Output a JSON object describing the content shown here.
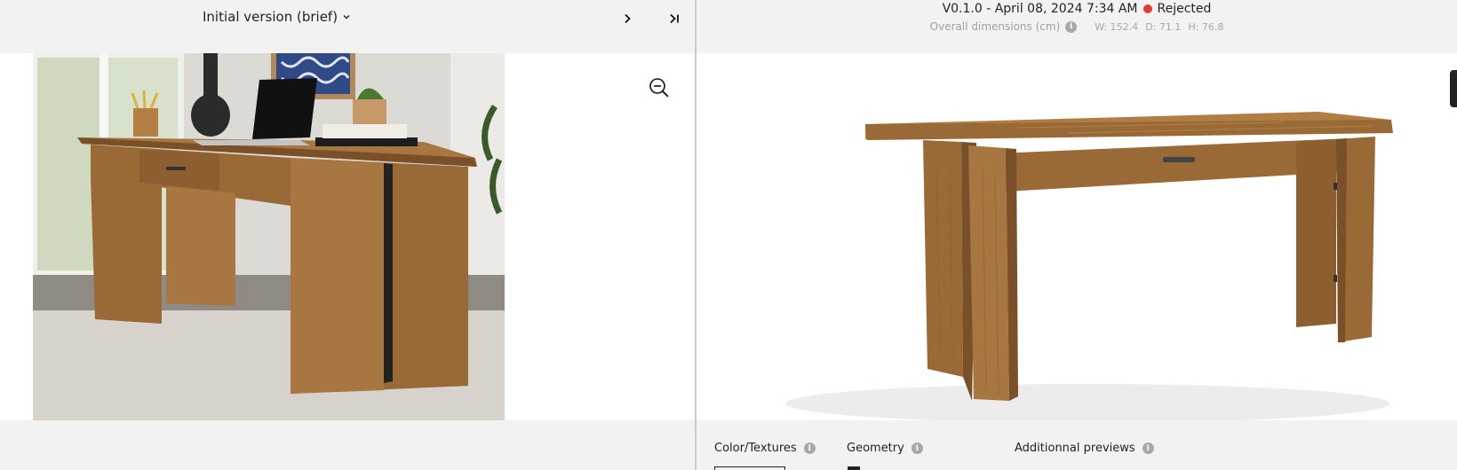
{
  "left": {
    "version_label": "Initial version (brief)",
    "next_icon": "chevron-right-icon",
    "last_icon": "skip-to-end-icon",
    "zoom_icon": "zoom-out-icon"
  },
  "right": {
    "version": "V0.1.0 - April 08, 2024 7:34 AM",
    "status": "Rejected",
    "status_color": "#e53935",
    "dimensions_label": "Overall dimensions (cm)",
    "width": "W: 152.4",
    "depth": "D: 71.1",
    "height": "H: 76.8"
  },
  "tabs": [
    {
      "label": "Color/Textures"
    },
    {
      "label": "Geometry"
    },
    {
      "label": "Additionnal previews"
    }
  ],
  "colors": {
    "wood": "#9a6a36",
    "wood_light": "#b07d45",
    "wood_dark": "#7a5029",
    "background": "#f2f2f2"
  }
}
